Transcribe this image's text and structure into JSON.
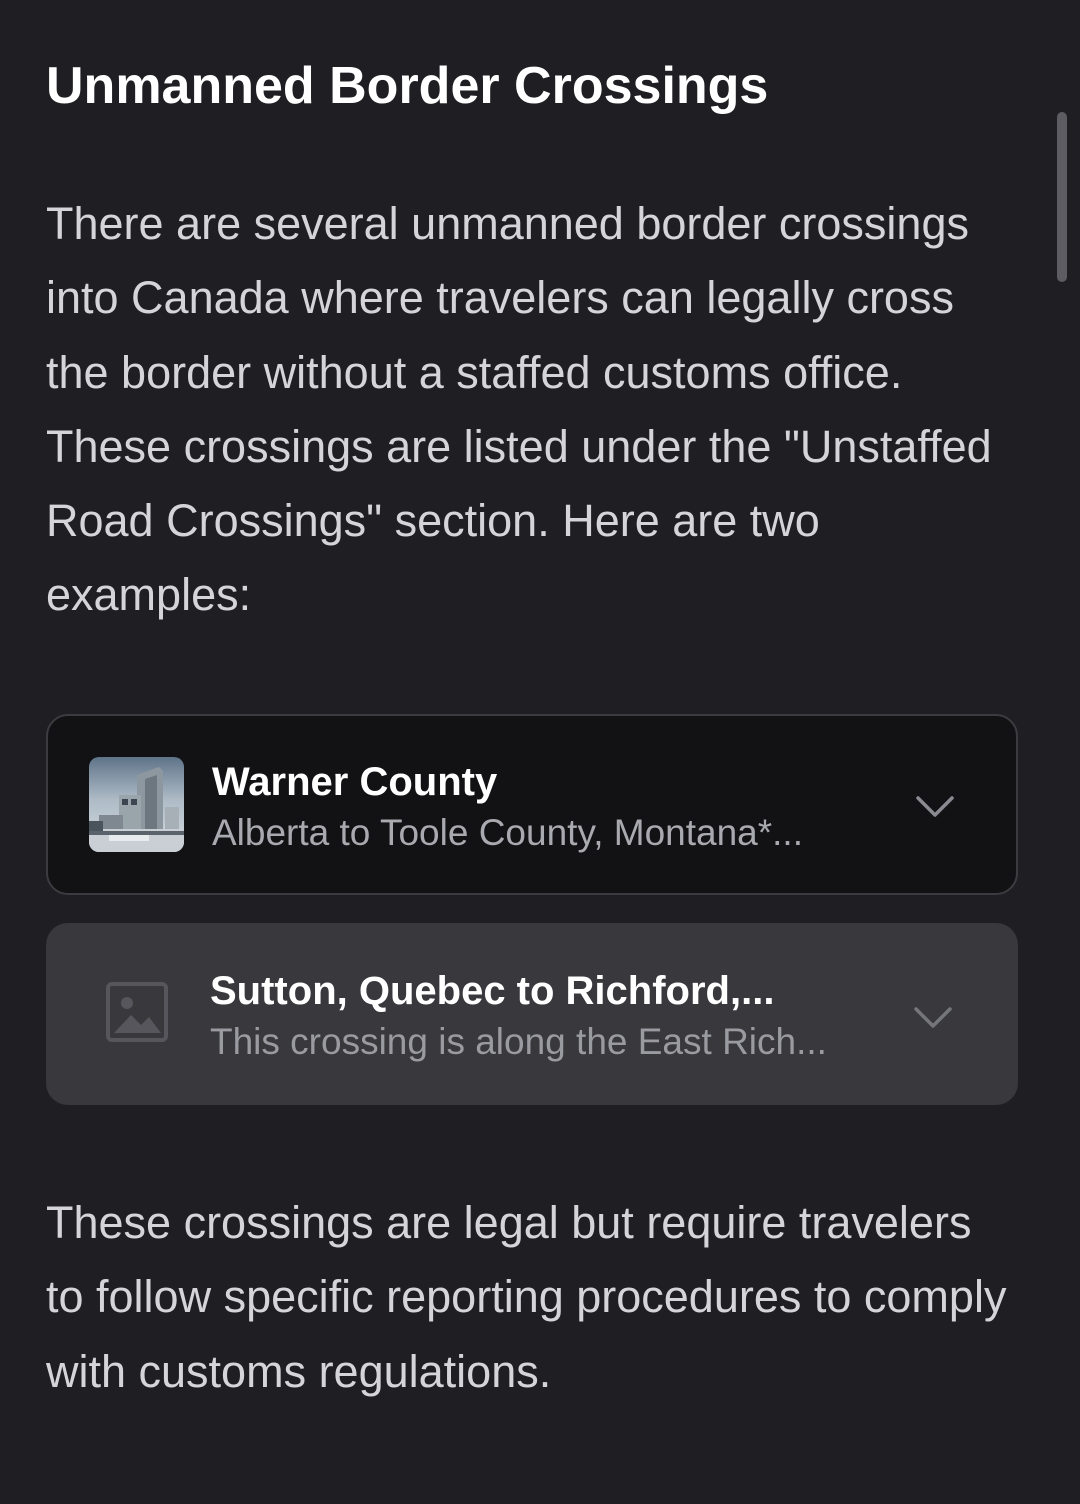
{
  "article": {
    "title": "Unmanned Border Crossings",
    "intro": "There are several unmanned border crossings into Canada where travelers can legally cross the border without a staffed customs office. These crossings are listed under the \"Unstaffed Road Crossings\" section. Here are two examples:",
    "outro": "These crossings are legal but require travelers to follow specific reporting procedures to comply with customs regulations."
  },
  "cards": [
    {
      "title": "Warner County",
      "subtitle": "Alberta to Toole County, Montana*...",
      "thumbnail": "border-station-photo",
      "icon": "chevron-down-icon"
    },
    {
      "title": "Sutton, Quebec to Richford,...",
      "subtitle": "This crossing is along the East Rich...",
      "thumbnail": "image-placeholder-icon",
      "icon": "chevron-down-icon"
    }
  ],
  "colors": {
    "background": "#1f1f23",
    "card_dark": "#121215",
    "card_highlight": "#38383d",
    "title_text": "#ffffff",
    "body_text": "#d4d4d9",
    "muted_text": "#a9a9b0"
  }
}
